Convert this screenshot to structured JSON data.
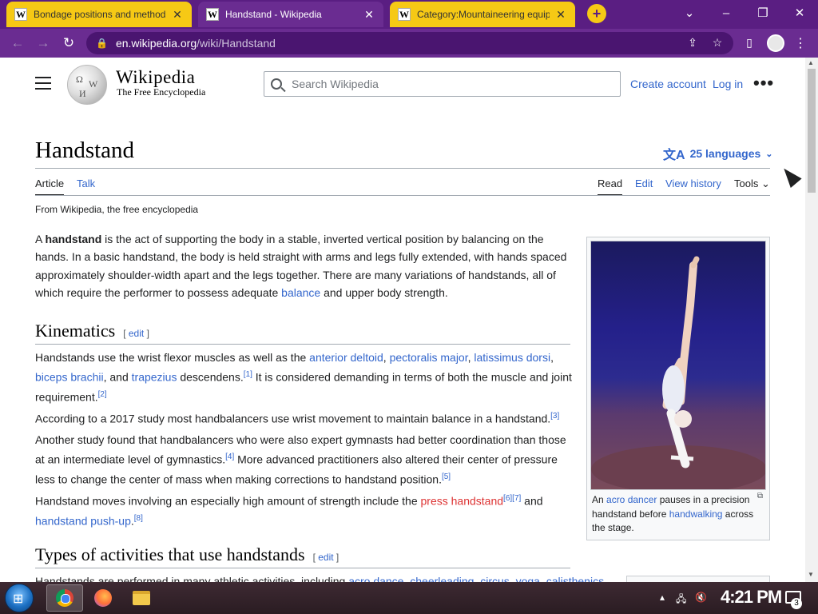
{
  "browser": {
    "tabs": [
      {
        "title": "Bondage positions and methods",
        "active": false
      },
      {
        "title": "Handstand - Wikipedia",
        "active": true
      },
      {
        "title": "Category:Mountaineering equipm",
        "active": false
      }
    ],
    "url_host": "en.wikipedia.org",
    "url_path": "/wiki/Handstand",
    "accent_color": "#6a2c91",
    "tab_inactive_color": "#f6c915"
  },
  "wiki": {
    "wordmark": "Wikipedia",
    "tagline": "The Free Encyclopedia",
    "search_placeholder": "Search Wikipedia",
    "create_account": "Create account",
    "log_in": "Log in",
    "more": "•••"
  },
  "article": {
    "title": "Handstand",
    "languages": "25 languages",
    "tabs": {
      "article": "Article",
      "talk": "Talk",
      "read": "Read",
      "edit": "Edit",
      "history": "View history",
      "tools": "Tools"
    },
    "from_wiki": "From Wikipedia, the free encyclopedia",
    "intro": {
      "a": "A ",
      "bold": "handstand",
      "b": " is the act of supporting the body in a stable, inverted vertical position by balancing on the hands. In a basic handstand, the body is held straight with arms and legs fully extended, with hands spaced approximately shoulder-width apart and the legs together. There are many variations of handstands, all of which require the performer to possess adequate ",
      "link_balance": "balance",
      "c": " and upper body strength."
    },
    "kinematics": {
      "heading": "Kinematics",
      "edit": "edit",
      "p1_a": "Handstands use the wrist flexor muscles as well as the ",
      "link_deltoid": "anterior deltoid",
      "sep1": ", ",
      "link_pec": "pectoralis major",
      "sep2": ", ",
      "link_lat": "latissimus dorsi",
      "sep3": ", ",
      "link_biceps": "biceps brachii",
      "sep4": ", and ",
      "link_trap": "trapezius",
      "p1_b": " descendens.",
      "ref1": "[1]",
      "p1_c": " It is considered demanding in terms of both the muscle and joint requirement.",
      "ref2": "[2]",
      "p2": "According to a 2017 study most handbalancers use wrist movement to maintain balance in a handstand.",
      "ref3": "[3]",
      "p3_a": "Another study found that handbalancers who were also expert gymnasts had better coordination than those at an intermediate level of gymnastics.",
      "ref4": "[4]",
      "p3_b": " More advanced practitioners also altered their center of pressure less to change the center of mass when making corrections to handstand position.",
      "ref5": "[5]",
      "p4_a": "Handstand moves involving an especially high amount of strength include the ",
      "link_press": "press handstand",
      "ref6": "[6]",
      "ref7": "[7]",
      "p4_b": " and ",
      "link_pushup": "handstand push-up",
      "p4_c": ".",
      "ref8": "[8]"
    },
    "types": {
      "heading": "Types of activities that use handstands",
      "edit": "edit",
      "p1_a": "Handstands are performed in many athletic activities, including ",
      "link_acro": "acro dance",
      "sep1": ", ",
      "link_cheer": "cheerleading",
      "sep2": ", ",
      "link_circus": "circus",
      "sep3": ", ",
      "link_yoga": "yoga",
      "sep4": ", ",
      "link_cal": "calisthenics"
    },
    "caption": {
      "a": "An ",
      "link_acro": "acro dancer",
      "b": " pauses in a precision handstand before ",
      "link_walk": "handwalking",
      "c": " across the stage."
    }
  },
  "taskbar": {
    "clock": "4:21 PM",
    "notifications": "3"
  }
}
